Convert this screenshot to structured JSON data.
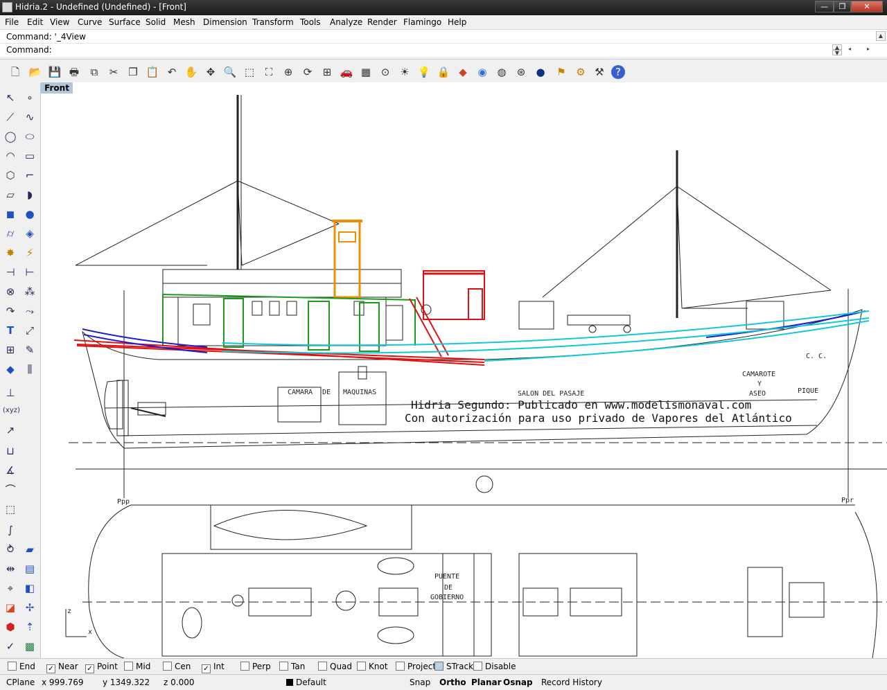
{
  "window": {
    "title": "Hidria.2 - Undefined (Undefined) - [Front]",
    "controls": {
      "minimize": "—",
      "maximize": "❐",
      "close": "✕"
    }
  },
  "menu": [
    "File",
    "Edit",
    "View",
    "Curve",
    "Surface",
    "Solid",
    "Mesh",
    "Dimension",
    "Transform",
    "Tools",
    "Analyze",
    "Render",
    "Flamingo",
    "Help"
  ],
  "command": {
    "history": "Command: '_4View",
    "prompt": "Command:"
  },
  "viewport": {
    "tab": "Front",
    "overlay_line1": "Hidria Segundo: Publicado en www.modelismonaval.com",
    "overlay_line2": "Con autorización para uso privado de Vapores del Atlántico",
    "drawing_labels": {
      "camara": "CAMARA",
      "de": "DE",
      "maquinas": "MAQUINAS",
      "salon": "SALON DEL PASAJE",
      "camarote": "CAMAROTE",
      "y": "Y",
      "aseo": "ASEO",
      "cc": "C. C.",
      "pique": "PIQUE",
      "ppp": "Ppp",
      "ppr": "Ppr",
      "puente": "PUENTE",
      "de2": "DE",
      "gobierno": "GOBIERNO",
      "axis_z": "z",
      "axis_x": "x"
    }
  },
  "osnaps": [
    {
      "label": "End",
      "checked": false
    },
    {
      "label": "Near",
      "checked": true
    },
    {
      "label": "Point",
      "checked": true
    },
    {
      "label": "Mid",
      "checked": false
    },
    {
      "label": "Cen",
      "checked": false
    },
    {
      "label": "Int",
      "checked": true
    },
    {
      "label": "Perp",
      "checked": false
    },
    {
      "label": "Tan",
      "checked": false
    },
    {
      "label": "Quad",
      "checked": false
    },
    {
      "label": "Knot",
      "checked": false
    },
    {
      "label": "Project",
      "checked": false
    },
    {
      "label": "STrack",
      "checked": false
    },
    {
      "label": "Disable",
      "checked": false
    }
  ],
  "status": {
    "cplane": "CPlane",
    "x": "x 999.769",
    "y": "y 1349.322",
    "z": "z 0.000",
    "layer": "Default",
    "snap": "Snap",
    "ortho": "Ortho",
    "planar": "Planar",
    "osnap": "Osnap",
    "record_history": "Record History"
  },
  "toolbar_icons": [
    "new-icon",
    "open-icon",
    "save-icon",
    "print-icon",
    "import-icon",
    "cut-icon",
    "copy-icon",
    "paste-icon",
    "undo-icon",
    "pan-icon",
    "rotate-view-icon",
    "zoom-icon",
    "zoom-window-icon",
    "zoom-extents-icon",
    "zoom-selected-icon",
    "rotate-icon",
    "four-view-icon",
    "car-icon",
    "grid-icon",
    "point-icon",
    "light-icon",
    "bulb-icon",
    "lock-icon",
    "color-icon",
    "render-icon",
    "sphere-wire-icon",
    "sphere-icon",
    "flag-icon",
    "settings-icon",
    "tools-icon",
    "help-icon"
  ],
  "left_toolbar_icons": [
    "select-icon",
    "point-icon",
    "polyline-icon",
    "curve-icon",
    "circle-icon",
    "ellipse-icon",
    "arc-icon",
    "rectangle-icon",
    "polygon-icon",
    "fillet-icon",
    "surface-icon",
    "sweep-icon",
    "box-icon",
    "sphere-icon",
    "cylinder-icon",
    "loft-icon",
    "explode-icon",
    "trim-icon",
    "boolean-icon",
    "split-icon",
    "text-icon",
    "join-icon",
    "group-icon",
    "dimension-icon",
    "solid-icon",
    "hatch-icon",
    "xyz-icon",
    "move-icon",
    "scale-icon",
    "mirror-icon",
    "array-icon",
    "rotate-icon",
    "bend-icon",
    "flow-icon",
    "analyze-icon",
    "curvature-icon",
    "render-icon",
    "material-icon",
    "layer-icon",
    "check-icon"
  ]
}
